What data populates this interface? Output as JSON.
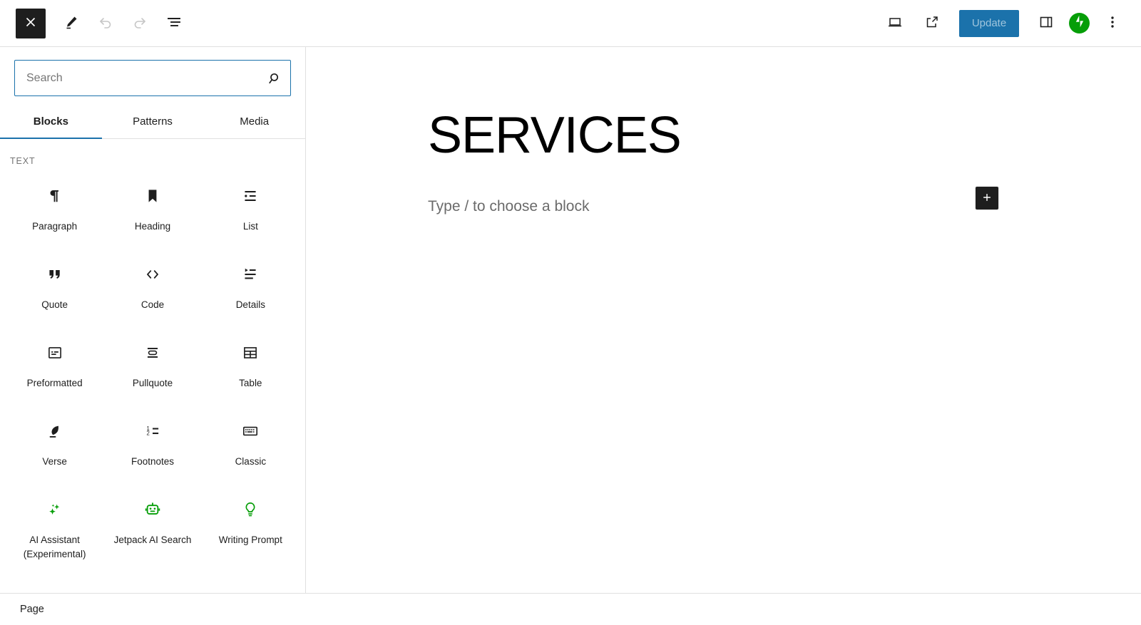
{
  "topbar": {
    "close_label": "Close",
    "left_tools": [
      {
        "name": "close-button",
        "icon": "close-icon",
        "label": "Close"
      },
      {
        "name": "edit-tool-button",
        "icon": "pencil-icon",
        "label": "Tools"
      },
      {
        "name": "undo-button",
        "icon": "undo-icon",
        "label": "Undo",
        "disabled": true
      },
      {
        "name": "redo-button",
        "icon": "redo-icon",
        "label": "Redo",
        "disabled": true
      },
      {
        "name": "document-overview-button",
        "icon": "list-view-icon",
        "label": "Document Overview"
      }
    ],
    "right_tools": [
      {
        "name": "view-device-button",
        "icon": "desktop-icon",
        "label": "View"
      },
      {
        "name": "preview-external-button",
        "icon": "external-link-icon",
        "label": "Preview in new tab"
      }
    ],
    "update_label": "Update",
    "update_bg": "#1b72ab",
    "update_text_color": "#9fc5dd",
    "settings_label": "Settings",
    "jetpack_label": "Jetpack",
    "jetpack_color": "#069e08",
    "options_label": "Options"
  },
  "inserter": {
    "search": {
      "placeholder": "Search",
      "value": "",
      "icon": "search-icon",
      "border_color": "#1b72ab"
    },
    "tabs": [
      {
        "label": "Blocks",
        "active": true
      },
      {
        "label": "Patterns",
        "active": false
      },
      {
        "label": "Media",
        "active": false
      }
    ],
    "active_tab_color": "#1b72ab",
    "section_label": "TEXT",
    "blocks": [
      {
        "label": "Paragraph",
        "icon": "paragraph-icon",
        "color": "#1e1e1e"
      },
      {
        "label": "Heading",
        "icon": "heading-bookmark-icon",
        "color": "#1e1e1e"
      },
      {
        "label": "List",
        "icon": "list-icon",
        "color": "#1e1e1e"
      },
      {
        "label": "Quote",
        "icon": "quote-icon",
        "color": "#1e1e1e"
      },
      {
        "label": "Code",
        "icon": "code-icon",
        "color": "#1e1e1e"
      },
      {
        "label": "Details",
        "icon": "details-icon",
        "color": "#1e1e1e"
      },
      {
        "label": "Preformatted",
        "icon": "preformatted-icon",
        "color": "#1e1e1e"
      },
      {
        "label": "Pullquote",
        "icon": "pullquote-icon",
        "color": "#1e1e1e"
      },
      {
        "label": "Table",
        "icon": "table-icon",
        "color": "#1e1e1e"
      },
      {
        "label": "Verse",
        "icon": "verse-feather-icon",
        "color": "#1e1e1e"
      },
      {
        "label": "Footnotes",
        "icon": "footnotes-icon",
        "color": "#1e1e1e"
      },
      {
        "label": "Classic",
        "icon": "classic-keyboard-icon",
        "color": "#1e1e1e"
      },
      {
        "label": "AI Assistant (Experimental)",
        "icon": "sparkles-icon",
        "color": "#069e08"
      },
      {
        "label": "Jetpack AI Search",
        "icon": "robot-icon",
        "color": "#069e08"
      },
      {
        "label": "Writing Prompt",
        "icon": "lightbulb-icon",
        "color": "#069e08"
      }
    ]
  },
  "canvas": {
    "post_title": "SERVICES",
    "block_placeholder": "Type / to choose a block",
    "add_block_label": "Add block"
  },
  "statusbar": {
    "label": "Page"
  }
}
